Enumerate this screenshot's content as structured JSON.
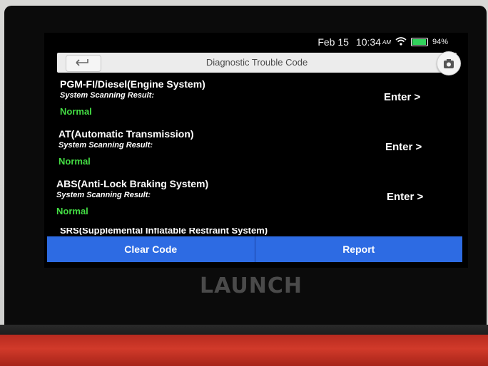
{
  "status": {
    "date": "Feb 15",
    "time": "10:34",
    "ampm": "AM",
    "battery_percent": "94%",
    "battery_level": 0.94
  },
  "header": {
    "title": "Diagnostic Trouble Code",
    "back_icon": "back-icon",
    "camera_icon": "camera-icon"
  },
  "systems": [
    {
      "name": "PGM-FI/Diesel(Engine System)",
      "subtitle": "System Scanning Result:",
      "result": "Normal",
      "action": "Enter >"
    },
    {
      "name": "AT(Automatic Transmission)",
      "subtitle": "System Scanning Result:",
      "result": "Normal",
      "action": "Enter >"
    },
    {
      "name": "ABS(Anti-Lock Braking System)",
      "subtitle": "System Scanning Result:",
      "result": "Normal",
      "action": "Enter >"
    },
    {
      "name": "SRS(Supplemental Inflatable Restraint System)"
    }
  ],
  "footer": {
    "left": "Clear Code",
    "right": "Report"
  },
  "brand": {
    "logo": "LAUNCH"
  },
  "colors": {
    "accent": "#2d6be3",
    "normal": "#44dd44",
    "battery": "#31d35c"
  }
}
